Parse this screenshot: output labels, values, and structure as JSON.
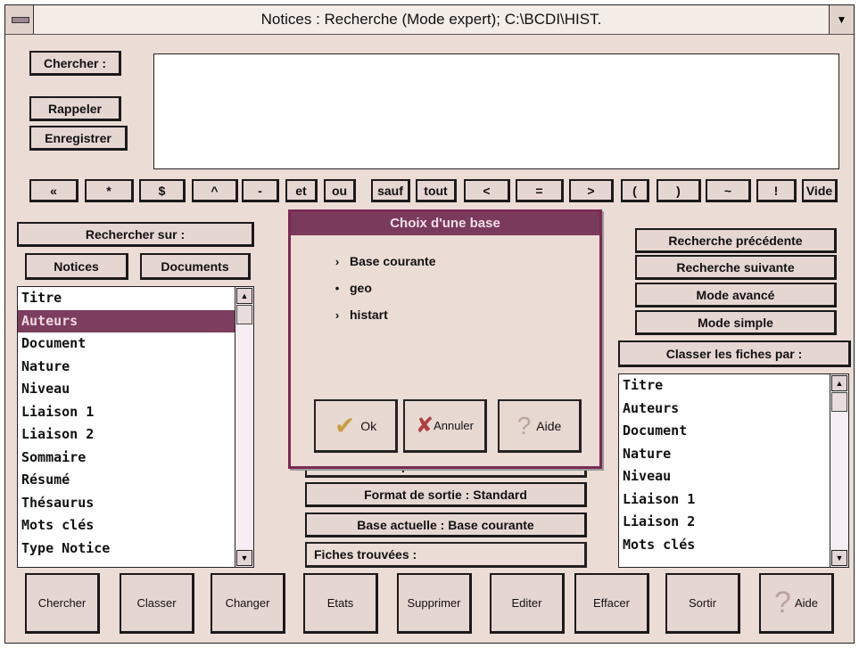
{
  "window": {
    "title": "Notices : Recherche (Mode expert); C:\\BCDI\\HIST.",
    "dropdown_glyph": "▼"
  },
  "search": {
    "label": "Chercher :",
    "query": "",
    "rappeler_label": "Rappeler",
    "enregistrer_label": "Enregistrer"
  },
  "operators": [
    "«",
    "*",
    "$",
    "^",
    "-",
    "et",
    "ou",
    "sauf",
    "tout",
    "<",
    "=",
    ">",
    "(",
    ")",
    "~",
    "!",
    "Vide"
  ],
  "left": {
    "header": "Rechercher sur :",
    "notices_label": "Notices",
    "documents_label": "Documents",
    "fields": [
      "Titre",
      "Auteurs",
      "Document",
      "Nature",
      "Niveau",
      "Liaison 1",
      "Liaison 2",
      "Sommaire",
      "Résumé",
      "Thésaurus",
      "Mots clés",
      "Type Notice"
    ],
    "selected_index": 1
  },
  "middle": {
    "panier_label": "Mettre dans le panier",
    "format_label": "Format de sortie : Standard",
    "base_label": "Base actuelle : Base courante",
    "fiches_label": "Fiches trouvées :"
  },
  "right": {
    "prev_label": "Recherche précédente",
    "next_label": "Recherche suivante",
    "advanced_label": "Mode avancé",
    "simple_label": "Mode simple",
    "sort_label": "Classer les fiches  par :",
    "sort_fields": [
      "Titre",
      "Auteurs",
      "Document",
      "Nature",
      "Niveau",
      "Liaison 1",
      "Liaison 2",
      "Mots clés"
    ]
  },
  "dialog": {
    "title": "Choix d'une base",
    "options": [
      {
        "label": "Base courante",
        "marker": "›"
      },
      {
        "label": "geo",
        "marker": "•"
      },
      {
        "label": "histart",
        "marker": "›"
      }
    ],
    "selected": "geo",
    "ok_label": "Ok",
    "annuler_label": "Annuler",
    "aide_label": "Aide"
  },
  "toolbar": {
    "buttons": [
      "Chercher",
      "Classer",
      "Changer",
      "Etats",
      "Supprimer",
      "Editer",
      "Effacer",
      "Sortir"
    ],
    "aide_label": "Aide"
  },
  "colors": {
    "window_bg": "#ecdcd6",
    "selection": "#7d3d5e",
    "dialog_title": "#7a3a5c"
  }
}
